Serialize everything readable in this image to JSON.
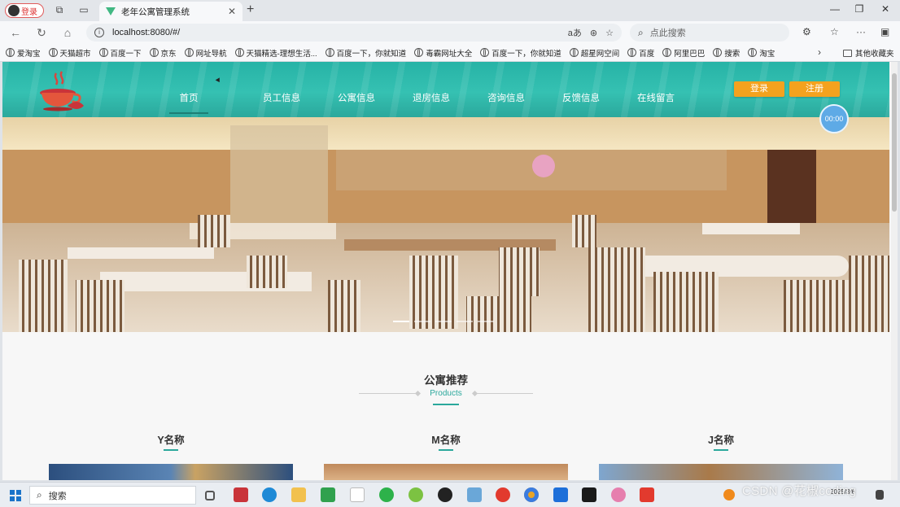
{
  "browser": {
    "profile_label": "登录",
    "tab_title": "老年公寓管理系统",
    "url": "localhost:8080/#/",
    "search_placeholder": "点此搜索",
    "favorites": [
      "爱淘宝",
      "天猫超市",
      "百度一下",
      "京东",
      "网址导航",
      "天猫精选-理想生活...",
      "百度一下，你就知道",
      "毒霸网址大全",
      "百度一下，你就知道",
      "超星网空间",
      "百度",
      "阿里巴巴",
      "搜索",
      "淘宝"
    ],
    "favorites_folder": "其他收藏夹"
  },
  "site": {
    "menu": [
      "首页",
      "员工信息",
      "公寓信息",
      "退房信息",
      "咨询信息",
      "反馈信息",
      "在线留言"
    ],
    "login_button": "登录",
    "register_button": "注册",
    "clock": "00:00"
  },
  "section": {
    "title": "公寓推荐",
    "subtitle": "Products",
    "products": [
      "Y名称",
      "M名称",
      "J名称"
    ]
  },
  "taskbar": {
    "search_placeholder": "搜索",
    "date": "2025/3/6"
  },
  "watermark": "CSDN @花椒coding"
}
